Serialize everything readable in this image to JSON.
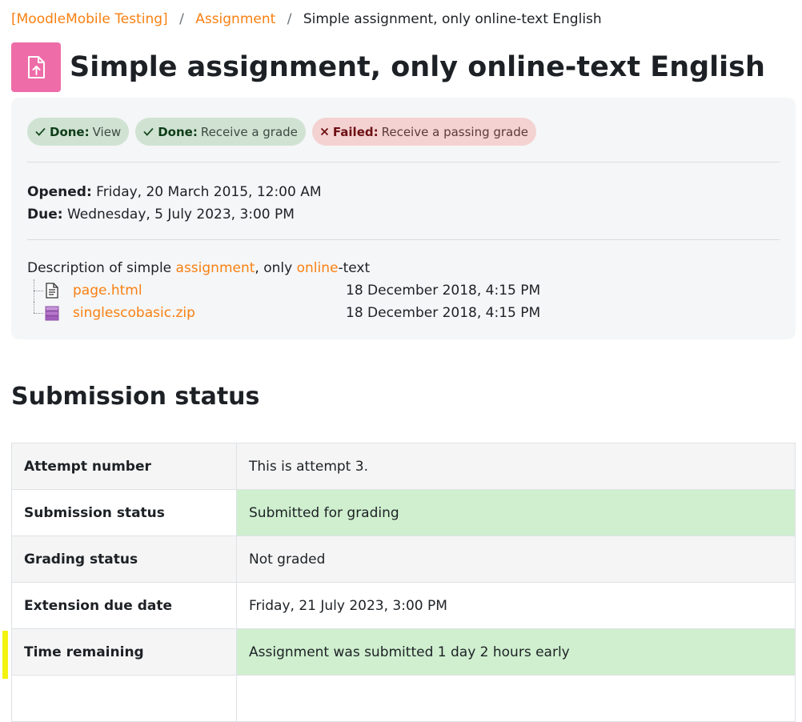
{
  "breadcrumb": {
    "course": "[MoodleMobile Testing]",
    "section": "Assignment",
    "current": "Simple assignment, only online-text English"
  },
  "page": {
    "title": "Simple assignment, only online-text English",
    "icon": "assignment-upload-icon",
    "icon_color": "#ee6ca8"
  },
  "completion": [
    {
      "status": "Done:",
      "text": "View",
      "state": "done"
    },
    {
      "status": "Done:",
      "text": "Receive a grade",
      "state": "done"
    },
    {
      "status": "Failed:",
      "text": "Receive a passing grade",
      "state": "failed"
    }
  ],
  "dates": {
    "opened_label": "Opened:",
    "opened_value": "Friday, 20 March 2015, 12:00 AM",
    "due_label": "Due:",
    "due_value": "Wednesday, 5 July 2023, 3:00 PM"
  },
  "description": {
    "part1": "Description of simple ",
    "link1": "assignment",
    "part2": ", only ",
    "link2": "online",
    "part3": "-text"
  },
  "files": [
    {
      "name": "page.html",
      "date": "18 December 2018, 4:15 PM",
      "icon": "html-file-icon"
    },
    {
      "name": "singlescobasic.zip",
      "date": "18 December 2018, 4:15 PM",
      "icon": "archive-file-icon"
    }
  ],
  "submission": {
    "heading": "Submission status",
    "rows": [
      {
        "label": "Attempt number",
        "value": "This is attempt 3."
      },
      {
        "label": "Submission status",
        "value": "Submitted for grading"
      },
      {
        "label": "Grading status",
        "value": "Not graded"
      },
      {
        "label": "Extension due date",
        "value": "Friday, 21 July 2023, 3:00 PM"
      },
      {
        "label": "Time remaining",
        "value": "Assignment was submitted 1 day 2 hours early"
      }
    ]
  },
  "colors": {
    "accent": "#f98012",
    "success_bg": "#cfefcf",
    "done_badge": "#d0e3d3",
    "failed_badge": "#f4d2d2",
    "highlight": "#f3f311"
  }
}
